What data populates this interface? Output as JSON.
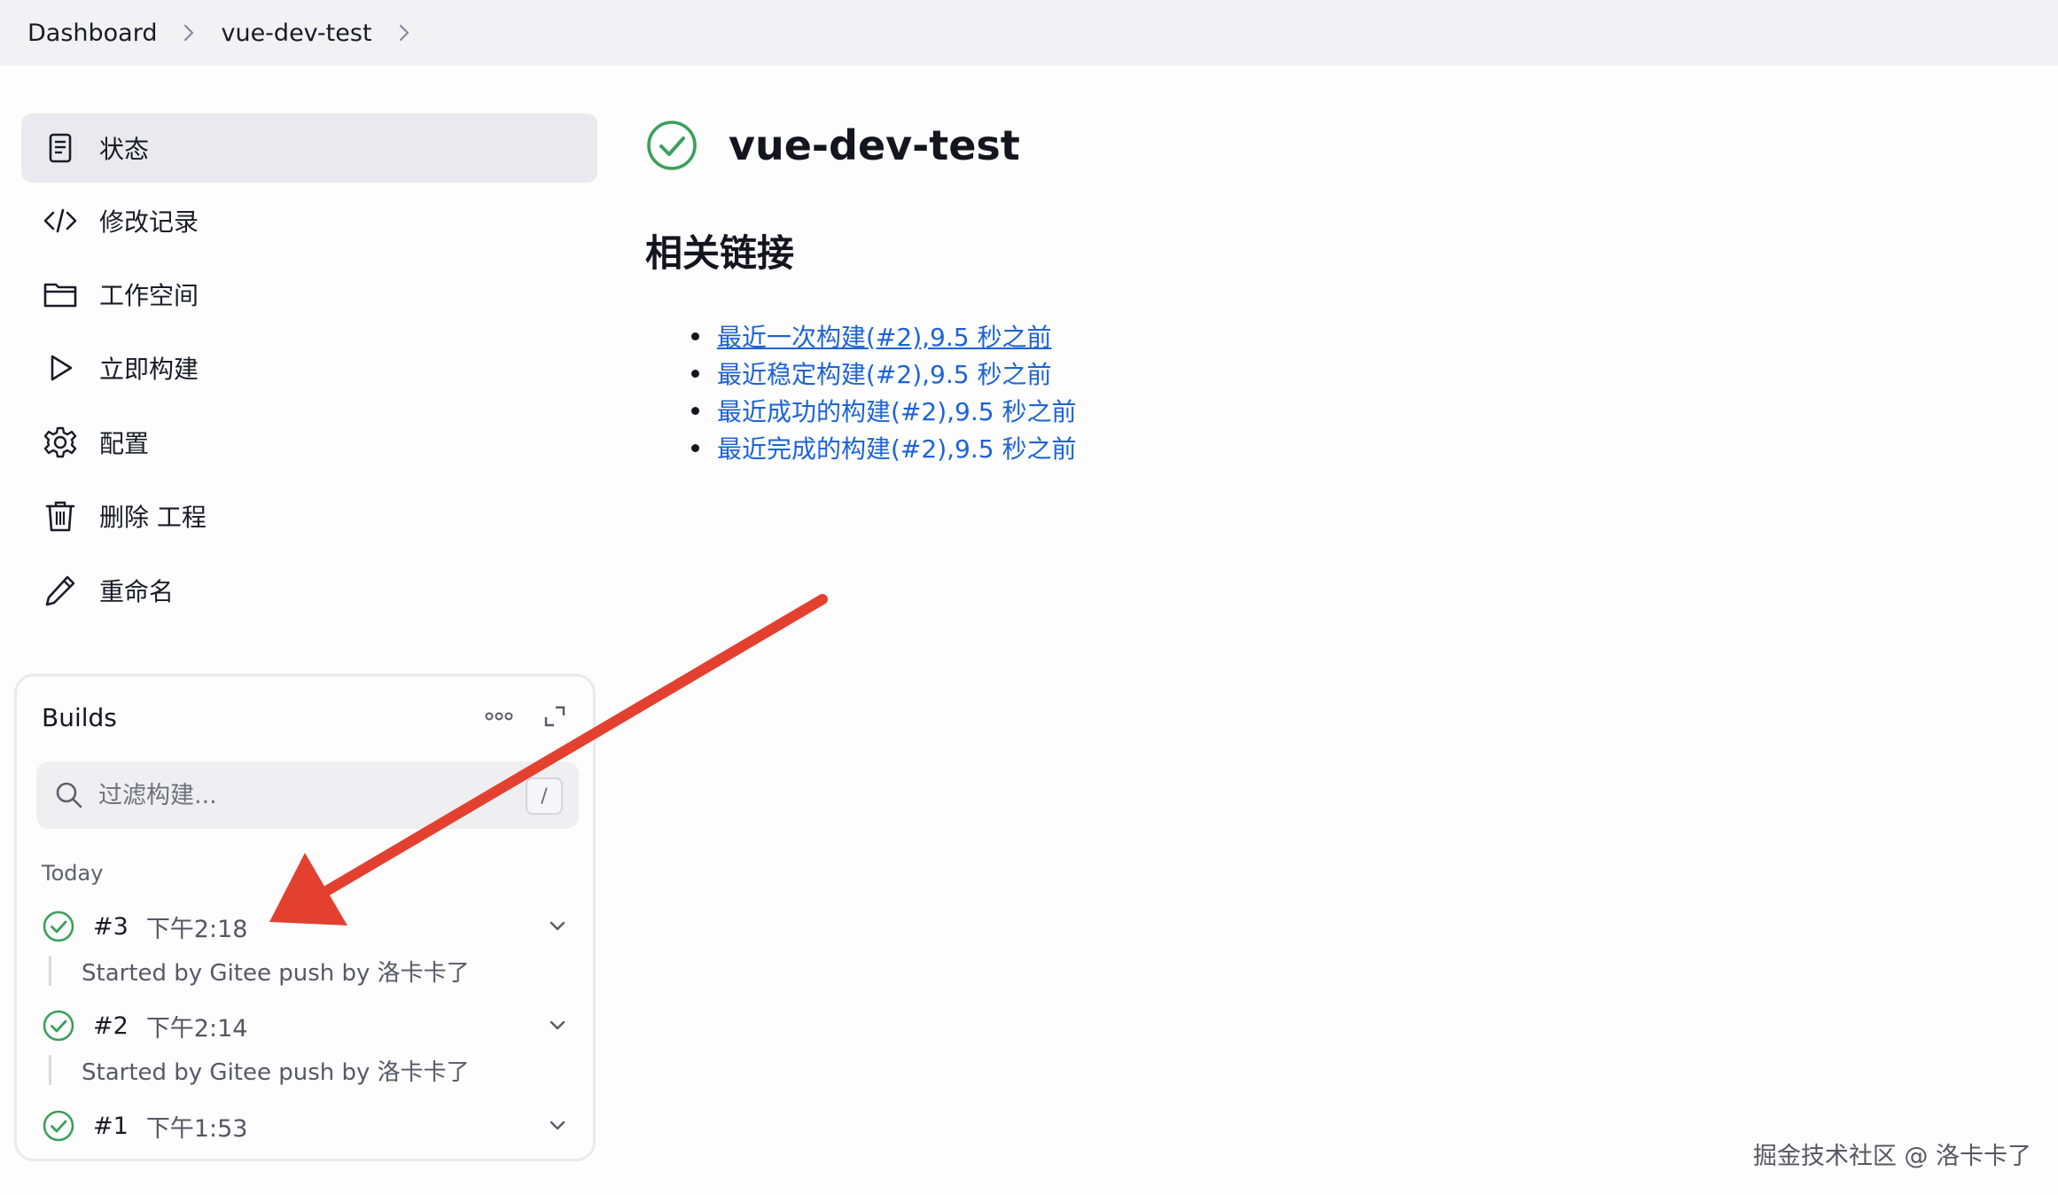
{
  "breadcrumb": {
    "items": [
      "Dashboard",
      "vue-dev-test"
    ]
  },
  "sidebar": {
    "items": [
      {
        "label": "状态",
        "icon": "document-icon",
        "active": true
      },
      {
        "label": "修改记录",
        "icon": "code-icon"
      },
      {
        "label": "工作空间",
        "icon": "folder-icon"
      },
      {
        "label": "立即构建",
        "icon": "play-icon"
      },
      {
        "label": "配置",
        "icon": "gear-icon"
      },
      {
        "label": "删除 工程",
        "icon": "trash-icon"
      },
      {
        "label": "重命名",
        "icon": "pencil-icon"
      }
    ]
  },
  "builds": {
    "title": "Builds",
    "filter_placeholder": "过滤构建...",
    "filter_shortcut": "/",
    "group_label": "Today",
    "items": [
      {
        "number": "#3",
        "time": "下午2:18",
        "cause": "Started by Gitee push by 洛卡卡了"
      },
      {
        "number": "#2",
        "time": "下午2:14",
        "cause": "Started by Gitee push by 洛卡卡了"
      },
      {
        "number": "#1",
        "time": "下午1:53",
        "cause": ""
      }
    ]
  },
  "main": {
    "title": "vue-dev-test",
    "section_title": "相关链接",
    "links": [
      "最近一次构建(#2),9.5 秒之前",
      "最近稳定构建(#2),9.5 秒之前",
      "最近成功的构建(#2),9.5 秒之前",
      "最近完成的构建(#2),9.5 秒之前"
    ]
  },
  "watermark": "掘金技术社区 @ 洛卡卡了",
  "colors": {
    "success": "#3aa05a",
    "link": "#1d63d6",
    "arrow": "#e4402f"
  }
}
